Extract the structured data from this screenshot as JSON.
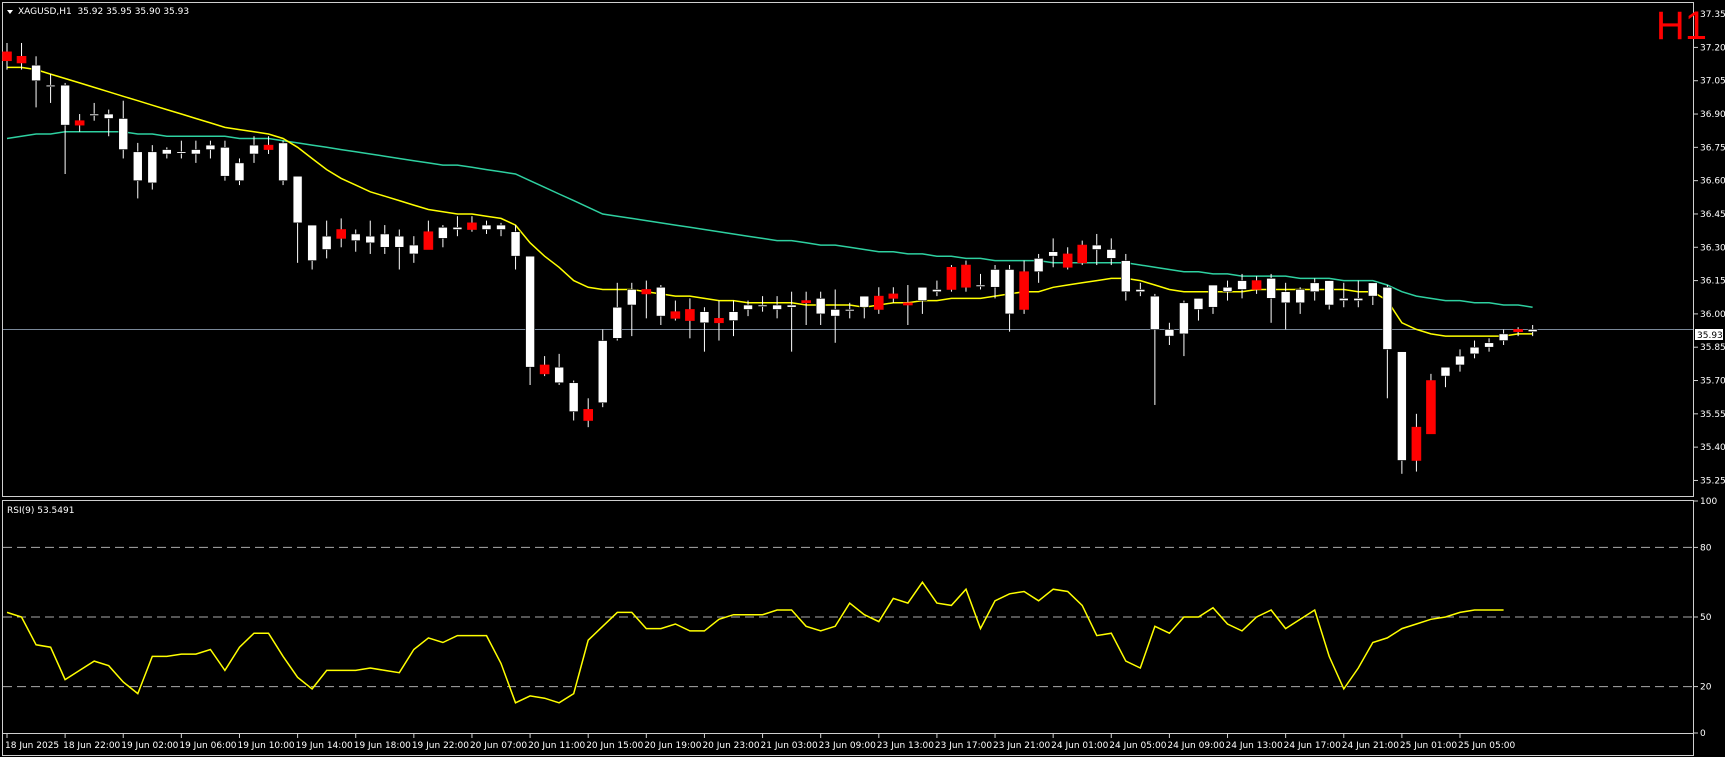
{
  "symbol_header": {
    "menu_icon": "triangle-down-icon",
    "text": "XAGUSD,H1  35.92 35.95 35.90 35.93"
  },
  "timeframe_label": "H1",
  "current_price_label": "35.93",
  "rsi_header": "RSI(9) 53.5491",
  "colors": {
    "background": "#000000",
    "bull_candle": "#ffffff",
    "bear_candle": "#ff0000",
    "wick": "#ffffff",
    "ma_fast": "#ffff00",
    "ma_slow": "#2ed0a0",
    "rsi_line": "#ffff00",
    "bid_line": "#7a8899",
    "grid_dash": "#aaaaaa",
    "timeframe_label": "#ff0000"
  },
  "chart_data": [
    {
      "type": "candlestick",
      "title": "XAGUSD,H1",
      "ylim": [
        35.18,
        37.4
      ],
      "y_ticks": [
        "37.35",
        "37.20",
        "37.05",
        "36.90",
        "36.75",
        "36.60",
        "36.45",
        "36.30",
        "36.15",
        "36.00",
        "35.85",
        "35.70",
        "35.55",
        "35.40",
        "35.25"
      ],
      "x_ticks": [
        "18 Jun 2025",
        "18 Jun 22:00",
        "19 Jun 02:00",
        "19 Jun 06:00",
        "19 Jun 10:00",
        "19 Jun 14:00",
        "19 Jun 18:00",
        "19 Jun 22:00",
        "20 Jun 07:00",
        "20 Jun 11:00",
        "20 Jun 15:00",
        "20 Jun 19:00",
        "20 Jun 23:00",
        "21 Jun 03:00",
        "23 Jun 09:00",
        "23 Jun 13:00",
        "23 Jun 17:00",
        "23 Jun 21:00",
        "24 Jun 01:00",
        "24 Jun 05:00",
        "24 Jun 09:00",
        "24 Jun 13:00",
        "24 Jun 17:00",
        "24 Jun 21:00",
        "25 Jun 01:00",
        "25 Jun 05:00"
      ],
      "candles": [
        [
          37.18,
          37.22,
          37.1,
          37.14
        ],
        [
          37.16,
          37.22,
          37.1,
          37.13
        ],
        [
          37.05,
          37.16,
          36.93,
          37.12
        ],
        [
          37.03,
          37.08,
          36.95,
          37.03
        ],
        [
          36.85,
          37.04,
          36.63,
          37.03
        ],
        [
          36.87,
          36.9,
          36.82,
          36.85
        ],
        [
          36.9,
          36.95,
          36.87,
          36.9
        ],
        [
          36.88,
          36.92,
          36.8,
          36.9
        ],
        [
          36.74,
          36.96,
          36.7,
          36.88
        ],
        [
          36.6,
          36.77,
          36.52,
          36.73
        ],
        [
          36.59,
          36.76,
          36.56,
          36.73
        ],
        [
          36.72,
          36.75,
          36.7,
          36.74
        ],
        [
          36.73,
          36.78,
          36.7,
          36.73
        ],
        [
          36.72,
          36.78,
          36.68,
          36.74
        ],
        [
          36.74,
          36.78,
          36.7,
          36.76
        ],
        [
          36.62,
          36.78,
          36.6,
          36.75
        ],
        [
          36.6,
          36.7,
          36.58,
          36.68
        ],
        [
          36.72,
          36.8,
          36.68,
          36.76
        ],
        [
          36.76,
          36.8,
          36.72,
          36.74
        ],
        [
          36.6,
          36.78,
          36.58,
          36.77
        ],
        [
          36.41,
          36.62,
          36.23,
          36.62
        ],
        [
          36.24,
          36.4,
          36.2,
          36.4
        ],
        [
          36.29,
          36.42,
          36.25,
          36.35
        ],
        [
          36.38,
          36.43,
          36.3,
          36.34
        ],
        [
          36.33,
          36.38,
          36.28,
          36.36
        ],
        [
          36.32,
          36.42,
          36.27,
          36.35
        ],
        [
          36.3,
          36.4,
          36.27,
          36.36
        ],
        [
          36.3,
          36.38,
          36.2,
          36.35
        ],
        [
          36.27,
          36.35,
          36.23,
          36.31
        ],
        [
          36.37,
          36.42,
          36.3,
          36.29
        ],
        [
          36.34,
          36.4,
          36.3,
          36.39
        ],
        [
          36.38,
          36.44,
          36.35,
          36.39
        ],
        [
          36.41,
          36.44,
          36.37,
          36.38
        ],
        [
          36.38,
          36.42,
          36.36,
          36.4
        ],
        [
          36.38,
          36.41,
          36.35,
          36.4
        ],
        [
          36.26,
          36.4,
          36.2,
          36.37
        ],
        [
          35.76,
          36.26,
          35.68,
          36.26
        ],
        [
          35.77,
          35.81,
          35.72,
          35.73
        ],
        [
          35.69,
          35.82,
          35.68,
          35.76
        ],
        [
          35.56,
          35.7,
          35.52,
          35.69
        ],
        [
          35.57,
          35.62,
          35.49,
          35.52
        ],
        [
          35.6,
          35.93,
          35.58,
          35.88
        ],
        [
          35.89,
          36.14,
          35.88,
          36.03
        ],
        [
          36.04,
          36.14,
          35.9,
          36.11
        ],
        [
          36.11,
          36.15,
          35.98,
          36.09
        ],
        [
          35.99,
          36.13,
          35.95,
          36.12
        ],
        [
          36.01,
          36.06,
          35.97,
          35.98
        ],
        [
          36.02,
          36.07,
          35.89,
          35.97
        ],
        [
          35.96,
          36.03,
          35.83,
          36.01
        ],
        [
          35.98,
          36.06,
          35.88,
          35.96
        ],
        [
          35.97,
          36.06,
          35.9,
          36.01
        ],
        [
          36.02,
          36.06,
          35.99,
          36.04
        ],
        [
          36.04,
          36.08,
          36.01,
          36.04
        ],
        [
          36.02,
          36.08,
          35.98,
          36.04
        ],
        [
          36.03,
          36.1,
          35.83,
          36.04
        ],
        [
          36.06,
          36.1,
          35.95,
          36.05
        ],
        [
          36.0,
          36.1,
          35.95,
          36.07
        ],
        [
          35.99,
          36.11,
          35.87,
          36.02
        ],
        [
          36.02,
          36.05,
          35.98,
          36.02
        ],
        [
          36.03,
          36.08,
          35.98,
          36.08
        ],
        [
          36.08,
          36.12,
          36.0,
          36.02
        ],
        [
          36.09,
          36.12,
          36.05,
          36.07
        ],
        [
          36.05,
          36.13,
          35.95,
          36.04
        ],
        [
          36.06,
          36.12,
          36.0,
          36.12
        ],
        [
          36.1,
          36.15,
          36.08,
          36.11
        ],
        [
          36.21,
          36.22,
          36.1,
          36.11
        ],
        [
          36.22,
          36.24,
          36.1,
          36.12
        ],
        [
          36.13,
          36.18,
          36.11,
          36.13
        ],
        [
          36.12,
          36.22,
          36.07,
          36.2
        ],
        [
          36.0,
          36.22,
          35.92,
          36.2
        ],
        [
          36.19,
          36.24,
          36.0,
          36.02
        ],
        [
          36.19,
          36.27,
          36.14,
          36.25
        ],
        [
          36.26,
          36.34,
          36.21,
          36.28
        ],
        [
          36.27,
          36.3,
          36.2,
          36.21
        ],
        [
          36.31,
          36.33,
          36.22,
          36.23
        ],
        [
          36.29,
          36.36,
          36.22,
          36.31
        ],
        [
          36.25,
          36.34,
          36.22,
          36.29
        ],
        [
          36.1,
          36.27,
          36.06,
          36.24
        ],
        [
          36.1,
          36.14,
          36.08,
          36.11
        ],
        [
          35.93,
          36.09,
          35.59,
          36.08
        ],
        [
          35.9,
          35.96,
          35.86,
          35.93
        ],
        [
          35.91,
          36.06,
          35.81,
          36.05
        ],
        [
          36.02,
          36.07,
          35.97,
          36.07
        ],
        [
          36.03,
          36.13,
          36.0,
          36.13
        ],
        [
          36.1,
          36.15,
          36.06,
          36.12
        ],
        [
          36.11,
          36.18,
          36.07,
          36.15
        ],
        [
          36.15,
          36.17,
          36.09,
          36.11
        ],
        [
          36.07,
          36.18,
          35.96,
          36.16
        ],
        [
          36.05,
          36.14,
          35.93,
          36.1
        ],
        [
          36.05,
          36.12,
          36.0,
          36.11
        ],
        [
          36.1,
          36.16,
          36.06,
          36.14
        ],
        [
          36.04,
          36.15,
          36.02,
          36.15
        ],
        [
          36.06,
          36.14,
          36.03,
          36.07
        ],
        [
          36.06,
          36.15,
          36.03,
          36.07
        ],
        [
          36.08,
          36.14,
          36.04,
          36.14
        ],
        [
          35.84,
          36.13,
          35.62,
          36.12
        ],
        [
          35.34,
          35.83,
          35.28,
          35.83
        ],
        [
          35.49,
          35.55,
          35.29,
          35.34
        ],
        [
          35.7,
          35.73,
          35.48,
          35.46
        ],
        [
          35.72,
          35.76,
          35.67,
          35.76
        ],
        [
          35.77,
          35.84,
          35.74,
          35.81
        ],
        [
          35.82,
          35.88,
          35.8,
          35.85
        ],
        [
          35.85,
          35.89,
          35.83,
          35.87
        ],
        [
          35.88,
          35.93,
          35.86,
          35.91
        ],
        [
          35.93,
          35.94,
          35.9,
          35.92
        ],
        [
          35.92,
          35.95,
          35.9,
          35.93
        ]
      ],
      "ma_fast": [
        37.11,
        37.11,
        37.1,
        37.08,
        37.06,
        37.04,
        37.02,
        37.0,
        36.98,
        36.96,
        36.94,
        36.92,
        36.9,
        36.88,
        36.86,
        36.84,
        36.83,
        36.82,
        36.81,
        36.79,
        36.75,
        36.7,
        36.65,
        36.61,
        36.58,
        36.55,
        36.53,
        36.51,
        36.49,
        36.47,
        36.46,
        36.45,
        36.45,
        36.44,
        36.43,
        36.4,
        36.32,
        36.26,
        36.21,
        36.15,
        36.12,
        36.11,
        36.11,
        36.11,
        36.1,
        36.09,
        36.08,
        36.08,
        36.07,
        36.06,
        36.06,
        36.05,
        36.05,
        36.05,
        36.05,
        36.04,
        36.04,
        36.04,
        36.04,
        36.03,
        36.04,
        36.05,
        36.05,
        36.06,
        36.06,
        36.07,
        36.07,
        36.07,
        36.08,
        36.09,
        36.1,
        36.1,
        36.12,
        36.13,
        36.14,
        36.15,
        36.16,
        36.16,
        36.15,
        36.13,
        36.11,
        36.1,
        36.1,
        36.1,
        36.1,
        36.1,
        36.11,
        36.11,
        36.11,
        36.11,
        36.11,
        36.11,
        36.11,
        36.1,
        36.1,
        36.06,
        35.96,
        35.93,
        35.91,
        35.9,
        35.9,
        35.9,
        35.9,
        35.9,
        35.91,
        35.91
      ],
      "ma_slow": [
        36.79,
        36.8,
        36.81,
        36.81,
        36.82,
        36.82,
        36.82,
        36.82,
        36.82,
        36.81,
        36.81,
        36.8,
        36.8,
        36.8,
        36.8,
        36.8,
        36.79,
        36.79,
        36.79,
        36.78,
        36.77,
        36.76,
        36.75,
        36.74,
        36.73,
        36.72,
        36.71,
        36.7,
        36.69,
        36.68,
        36.67,
        36.67,
        36.66,
        36.65,
        36.64,
        36.63,
        36.6,
        36.57,
        36.54,
        36.51,
        36.48,
        36.45,
        36.44,
        36.43,
        36.42,
        36.41,
        36.4,
        36.39,
        36.38,
        36.37,
        36.36,
        36.35,
        36.34,
        36.33,
        36.33,
        36.32,
        36.31,
        36.31,
        36.3,
        36.29,
        36.28,
        36.28,
        36.27,
        36.27,
        36.26,
        36.26,
        36.25,
        36.25,
        36.24,
        36.24,
        36.24,
        36.24,
        36.23,
        36.23,
        36.23,
        36.23,
        36.23,
        36.23,
        36.22,
        36.21,
        36.2,
        36.19,
        36.19,
        36.18,
        36.18,
        36.17,
        36.17,
        36.17,
        36.17,
        36.16,
        36.16,
        36.16,
        36.15,
        36.15,
        36.15,
        36.13,
        36.1,
        36.08,
        36.07,
        36.06,
        36.06,
        36.05,
        36.05,
        36.04,
        36.04,
        36.03
      ]
    },
    {
      "type": "line",
      "title": "RSI(9) 53.5491",
      "ylim": [
        0,
        100
      ],
      "y_ticks": [
        "100",
        "80",
        "50",
        "20",
        "0"
      ],
      "levels": [
        80,
        50,
        20
      ],
      "rsi": [
        52,
        50,
        38,
        37,
        23,
        27,
        31,
        29,
        22,
        17,
        33,
        33,
        34,
        34,
        36,
        27,
        37,
        43,
        43,
        33,
        24,
        19,
        27,
        27,
        27,
        28,
        27,
        26,
        36,
        41,
        39,
        42,
        42,
        42,
        30,
        13,
        16,
        15,
        13,
        17,
        40,
        46,
        52,
        52,
        45,
        45,
        47,
        44,
        44,
        49,
        51,
        51,
        51,
        53,
        53,
        46,
        44,
        46,
        56,
        51,
        48,
        58,
        56,
        65,
        56,
        55,
        62,
        45,
        57,
        60,
        61,
        57,
        62,
        61,
        55,
        42,
        43,
        31,
        28,
        46,
        43,
        50,
        50,
        54,
        47,
        44,
        50,
        53,
        45,
        49,
        53,
        33,
        19,
        28,
        39,
        41,
        45,
        47,
        49,
        50,
        52,
        53,
        53,
        53
      ]
    }
  ]
}
